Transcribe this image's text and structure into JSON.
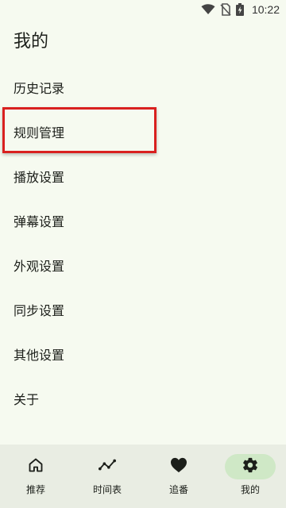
{
  "status_bar": {
    "time": "10:22",
    "icons": [
      "wifi-icon",
      "no-sim-icon",
      "battery-charging-icon"
    ]
  },
  "page": {
    "title": "我的"
  },
  "menu": {
    "items": [
      {
        "label": "历史记录"
      },
      {
        "label": "规则管理"
      },
      {
        "label": "播放设置"
      },
      {
        "label": "弹幕设置"
      },
      {
        "label": "外观设置"
      },
      {
        "label": "同步设置"
      },
      {
        "label": "其他设置"
      },
      {
        "label": "关于"
      }
    ],
    "highlighted_index": 1,
    "highlight_color": "#d9201f"
  },
  "bottom_nav": {
    "active_index": 3,
    "active_bg": "#cfe8c6",
    "items": [
      {
        "label": "推荐",
        "icon": "home-icon"
      },
      {
        "label": "时间表",
        "icon": "timeline-icon"
      },
      {
        "label": "追番",
        "icon": "heart-icon"
      },
      {
        "label": "我的",
        "icon": "gear-icon"
      }
    ]
  }
}
